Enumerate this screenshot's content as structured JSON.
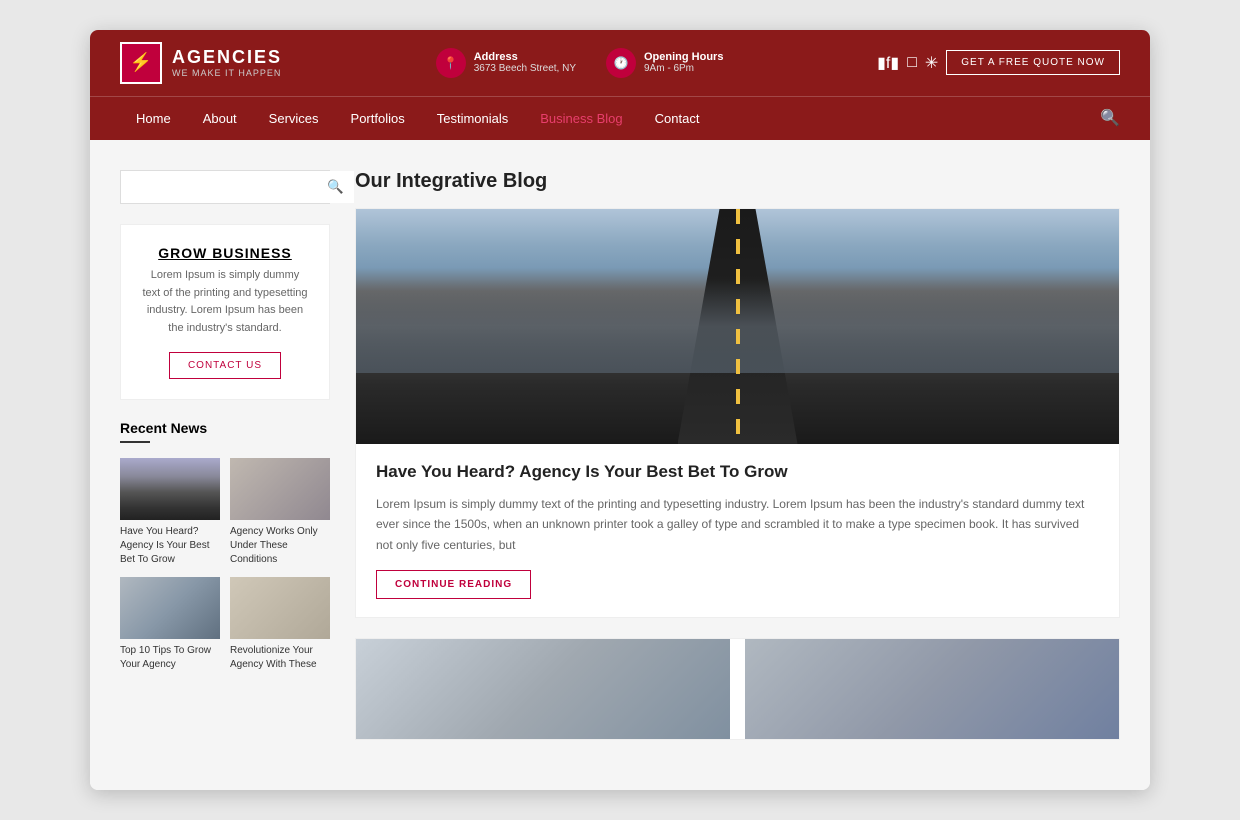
{
  "header": {
    "logo": {
      "icon": "⚡",
      "brand": "AGENCIES",
      "tagline": "WE MAKE IT HAPPEN"
    },
    "address": {
      "label": "Address",
      "value": "3673 Beech Street, NY"
    },
    "hours": {
      "label": "Opening Hours",
      "value": "9Am - 6Pm"
    },
    "button": "GET A FREE QUOTE NOW",
    "social": [
      "f",
      "📷",
      "✳"
    ]
  },
  "nav": {
    "items": [
      {
        "label": "Home",
        "active": false
      },
      {
        "label": "About",
        "active": false
      },
      {
        "label": "Services",
        "active": false
      },
      {
        "label": "Portfolios",
        "active": false
      },
      {
        "label": "Testimonials",
        "active": false
      },
      {
        "label": "Business Blog",
        "active": true
      },
      {
        "label": "Contact",
        "active": false
      }
    ]
  },
  "sidebar": {
    "search_placeholder": "",
    "grow_box": {
      "title": "GROW BUSINESS",
      "text": "Lorem Ipsum is simply dummy text of the printing and typesetting industry. Lorem Ipsum has been the industry's standard.",
      "button": "CONTACT US"
    },
    "recent_news": {
      "title": "Recent News",
      "items": [
        {
          "text": "Have You Heard? Agency Is Your Best Bet To Grow",
          "thumb": "road"
        },
        {
          "text": "Agency Works Only Under These Conditions",
          "thumb": "office"
        },
        {
          "text": "Top 10 Tips To Grow Your Agency",
          "thumb": "meeting"
        },
        {
          "text": "Revolutionize Your Agency With These",
          "thumb": "desk"
        }
      ]
    }
  },
  "blog": {
    "title": "Our Integrative Blog",
    "posts": [
      {
        "title": "Have You Heard? Agency Is Your Best Bet To Grow",
        "text": "Lorem Ipsum is simply dummy text of the printing and typesetting industry. Lorem Ipsum has been the industry's standard dummy text ever since the 1500s, when an unknown printer took a galley of type and scrambled it to make a type specimen book. It has survived not only five centuries, but",
        "continue_btn": "CONTINUE READING"
      }
    ]
  },
  "colors": {
    "brand_red": "#8b1a1a",
    "accent_pink": "#c0003c"
  }
}
